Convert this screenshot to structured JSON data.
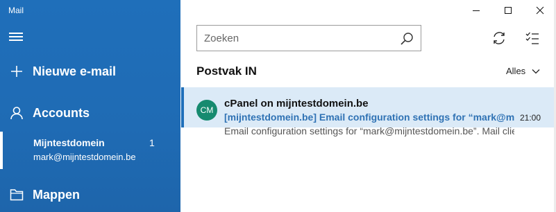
{
  "app": {
    "title": "Mail"
  },
  "sidebar": {
    "new_mail_label": "Nieuwe e-mail",
    "accounts_label": "Accounts",
    "account": {
      "name": "Mijntestdomein",
      "email": "mark@mijntestdomein.be",
      "unread": "1"
    },
    "folders_label": "Mappen"
  },
  "search": {
    "placeholder": "Zoeken",
    "value": ""
  },
  "list": {
    "folder_title": "Postvak IN",
    "filter_label": "Alles",
    "messages": [
      {
        "avatar_initials": "CM",
        "sender": "cPanel on mijntestdomein.be",
        "subject": "[mijntestdomein.be] Email configuration settings for “mark@mijntestdomein.be”",
        "time": "21:00",
        "preview": "Email configuration settings for “mark@mijntestdomein.be”. Mail client setup"
      }
    ]
  },
  "colors": {
    "sidebar": "#1f6fba",
    "selected_row": "#dbeaf7",
    "subject": "#2f72b4",
    "avatar": "#168a6f"
  },
  "icons": [
    "hamburger-icon",
    "plus-icon",
    "person-icon",
    "folder-icon",
    "search-icon",
    "sync-icon",
    "select-icon",
    "chevron-down-icon",
    "minimize-icon",
    "maximize-icon",
    "close-icon"
  ]
}
